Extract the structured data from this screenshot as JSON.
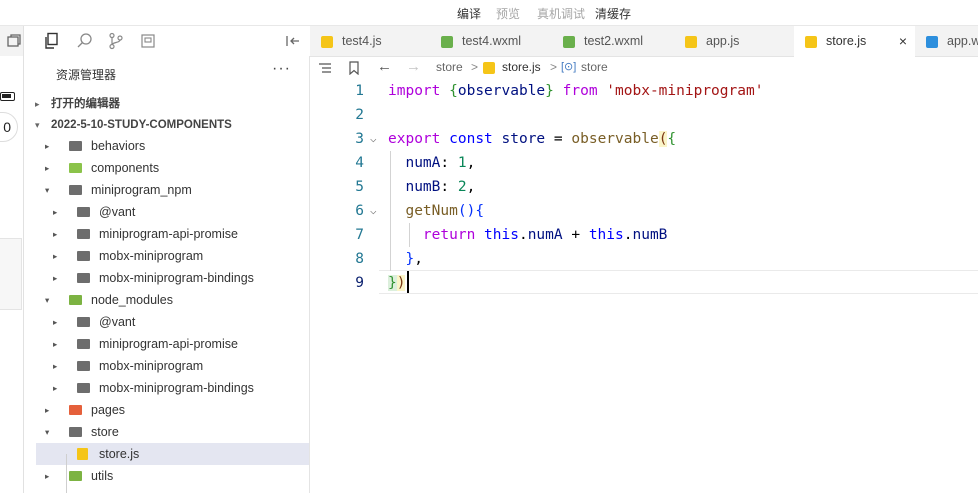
{
  "toolbar": {
    "compile": "编译",
    "preview": "预览",
    "device_debug": "真机调试",
    "clear_cache": "清缓存"
  },
  "simulator": {
    "capsule_text": "0"
  },
  "explorer": {
    "title": "资源管理器",
    "more": "···",
    "open_editors": "打开的编辑器",
    "project": "2022-5-10-STUDY-COMPONENTS",
    "tree": [
      {
        "label": "behaviors",
        "depth": 0,
        "caret": "▸",
        "icon": "folder",
        "color": "#6d6d6d"
      },
      {
        "label": "components",
        "depth": 0,
        "caret": "▸",
        "icon": "folder-components",
        "color": "#8bc34a"
      },
      {
        "label": "miniprogram_npm",
        "depth": 0,
        "caret": "▾",
        "icon": "folder-open",
        "color": "#6d6d6d"
      },
      {
        "label": "@vant",
        "depth": 1,
        "caret": "▸",
        "icon": "folder",
        "color": "#6d6d6d"
      },
      {
        "label": "miniprogram-api-promise",
        "depth": 1,
        "caret": "▸",
        "icon": "folder",
        "color": "#6d6d6d"
      },
      {
        "label": "mobx-miniprogram",
        "depth": 1,
        "caret": "▸",
        "icon": "folder",
        "color": "#6d6d6d"
      },
      {
        "label": "mobx-miniprogram-bindings",
        "depth": 1,
        "caret": "▸",
        "icon": "folder",
        "color": "#6d6d6d"
      },
      {
        "label": "node_modules",
        "depth": 0,
        "caret": "▾",
        "icon": "folder-node",
        "color": "#7cb342"
      },
      {
        "label": "@vant",
        "depth": 1,
        "caret": "▸",
        "icon": "folder",
        "color": "#6d6d6d"
      },
      {
        "label": "miniprogram-api-promise",
        "depth": 1,
        "caret": "▸",
        "icon": "folder",
        "color": "#6d6d6d"
      },
      {
        "label": "mobx-miniprogram",
        "depth": 1,
        "caret": "▸",
        "icon": "folder",
        "color": "#6d6d6d"
      },
      {
        "label": "mobx-miniprogram-bindings",
        "depth": 1,
        "caret": "▸",
        "icon": "folder",
        "color": "#6d6d6d"
      },
      {
        "label": "pages",
        "depth": 0,
        "caret": "▸",
        "icon": "folder-pages",
        "color": "#e5603b"
      },
      {
        "label": "store",
        "depth": 0,
        "caret": "▾",
        "icon": "folder-open",
        "color": "#6d6d6d"
      },
      {
        "label": "store.js",
        "depth": 1,
        "caret": "",
        "icon": "js-file",
        "color": "#f5c518",
        "selected": true
      },
      {
        "label": "utils",
        "depth": 0,
        "caret": "▸",
        "icon": "folder-utils",
        "color": "#7cb342"
      }
    ]
  },
  "tabs": [
    {
      "label": "test4.js",
      "icon": "js-file-icon",
      "color": "#f5c518",
      "active": false
    },
    {
      "label": "test4.wxml",
      "icon": "wxml-file-icon",
      "color": "#6ab04c",
      "active": false
    },
    {
      "label": "test2.wxml",
      "icon": "wxml-file-icon",
      "color": "#6ab04c",
      "active": false
    },
    {
      "label": "app.js",
      "icon": "js-file-icon",
      "color": "#f5c518",
      "active": false
    },
    {
      "label": "store.js",
      "icon": "js-file-icon",
      "color": "#f5c518",
      "active": true
    },
    {
      "label": "app.w",
      "icon": "css-file-icon",
      "color": "#2d8fdd",
      "active": false
    }
  ],
  "tab_close": "×",
  "breadcrumb": {
    "folder": "store",
    "file": "store.js",
    "symbol": "store",
    "sep": ">"
  },
  "editor": {
    "line_numbers": [
      "1",
      "2",
      "3",
      "4",
      "5",
      "6",
      "7",
      "8",
      "9"
    ],
    "current_line": 9
  }
}
